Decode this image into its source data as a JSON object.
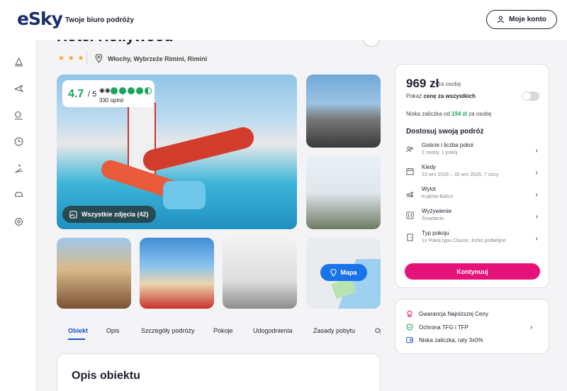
{
  "header": {
    "logo": "eSky",
    "tagline": "Twoje biuro podróży",
    "account_label": "Moje konto"
  },
  "rail": {
    "icons": [
      "beach-icon",
      "plane-icon",
      "tour-icon",
      "clock-icon",
      "ski-icon",
      "car-icon",
      "settings-icon"
    ]
  },
  "hotel": {
    "name": "Hotel Hollywood",
    "stars": "★ ★ ★",
    "location": "Włochy, Wybrzeże Rimini, Rimini"
  },
  "gallery": {
    "rating_score": "4.7",
    "rating_max": "/ 5",
    "reviews": "330 opinii",
    "all_photos_label": "Wszystkie zdjęcia (42)",
    "map_label": "Mapa"
  },
  "tabs": [
    "Obiekt",
    "Opis",
    "Szczegóły podróży",
    "Pokoje",
    "Udogodnienia",
    "Zasady pobytu",
    "Op"
  ],
  "description": {
    "title": "Opis obiektu"
  },
  "booking": {
    "price": "969 zł",
    "price_note": "za osobę",
    "toggle_prefix": "Pokaż",
    "toggle_bold": "cenę za wszystkich",
    "deposit_prefix": "Niska zaliczka od",
    "deposit_amount": "194 zł",
    "deposit_suffix": "za osobę",
    "customize_title": "Dostosuj swoją podróż",
    "options": [
      {
        "icon": "guests-icon",
        "title": "Goście i liczba pokoi",
        "sub": "2 osoby, 1 pokój"
      },
      {
        "icon": "calendar-icon",
        "title": "Kiedy",
        "sub": "23 wrz 2026 – 30 wrz 2026, 7 nocy"
      },
      {
        "icon": "departure-icon",
        "title": "Wylot",
        "sub": "Kraków Balice"
      },
      {
        "icon": "meal-icon",
        "title": "Wyżywienie",
        "sub": "Śniadanie"
      },
      {
        "icon": "room-icon",
        "title": "Typ pokoju",
        "sub": "1x Pokój typu Classic, łóżko podwójne"
      }
    ],
    "continue_label": "Kontynuuj"
  },
  "guarantees": [
    {
      "icon": "badge-icon",
      "label": "Gwarancja Najniższej Ceny"
    },
    {
      "icon": "shield-icon",
      "label": "Ochrona TFG i TFP"
    },
    {
      "icon": "wallet-icon",
      "label": "Niska zaliczka, raty 3x0%"
    }
  ],
  "colors": {
    "brand": "#1a2e6c",
    "accent": "#e5127a",
    "rating": "#1aa35a",
    "link": "#1a55c7"
  }
}
